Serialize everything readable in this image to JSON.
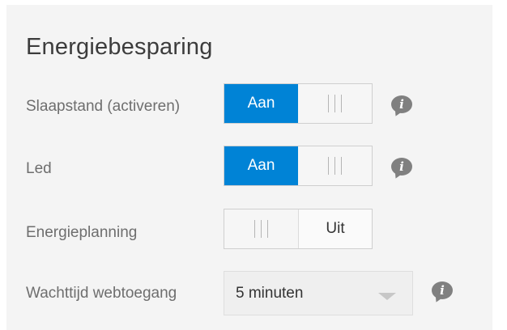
{
  "section": {
    "title": "Energiebesparing"
  },
  "settings": [
    {
      "label": "Slaapstand (activeren)",
      "on_label": "Aan",
      "state": "on",
      "has_info": true
    },
    {
      "label": "Led",
      "on_label": "Aan",
      "state": "on",
      "has_info": true
    },
    {
      "label": "Energieplanning",
      "off_label": "Uit",
      "state": "off",
      "has_info": false
    }
  ],
  "web_access_timeout": {
    "label": "Wachttijd webtoegang",
    "selected": "5 minuten"
  },
  "info_icon_glyph": "i",
  "colors": {
    "accent": "#0083d6",
    "panel": "#f4f4f4",
    "info_icon": "#808080"
  }
}
